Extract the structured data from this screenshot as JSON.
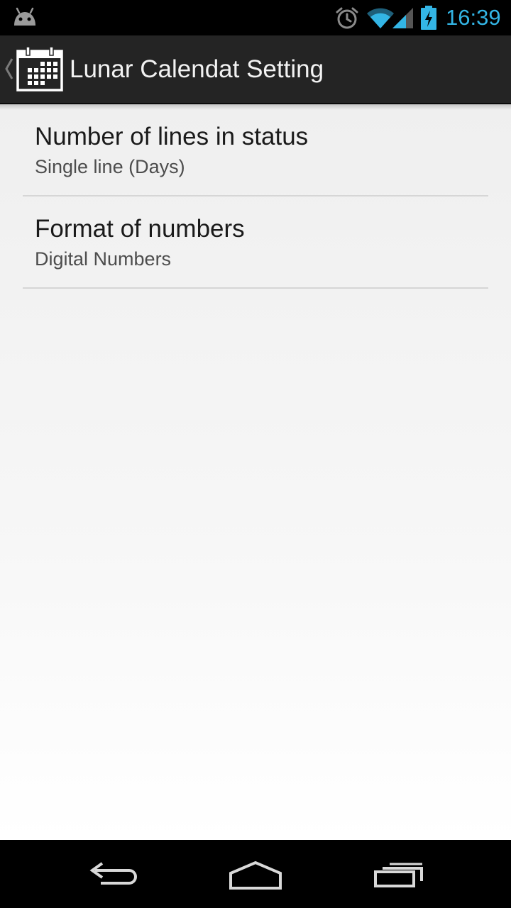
{
  "status_bar": {
    "time": "16:39",
    "icons": [
      "android-icon",
      "alarm-icon",
      "wifi-icon",
      "signal-icon",
      "battery-charging-icon"
    ],
    "time_color": "#33b5e5"
  },
  "action_bar": {
    "title": "Lunar Calendat Setting",
    "icon": "calendar-icon"
  },
  "preferences": [
    {
      "title": "Number of lines in status",
      "summary": "Single line (Days)"
    },
    {
      "title": "Format of numbers",
      "summary": "Digital Numbers"
    }
  ],
  "nav_bar": {
    "buttons": [
      "back-icon",
      "home-icon",
      "recents-icon"
    ]
  }
}
